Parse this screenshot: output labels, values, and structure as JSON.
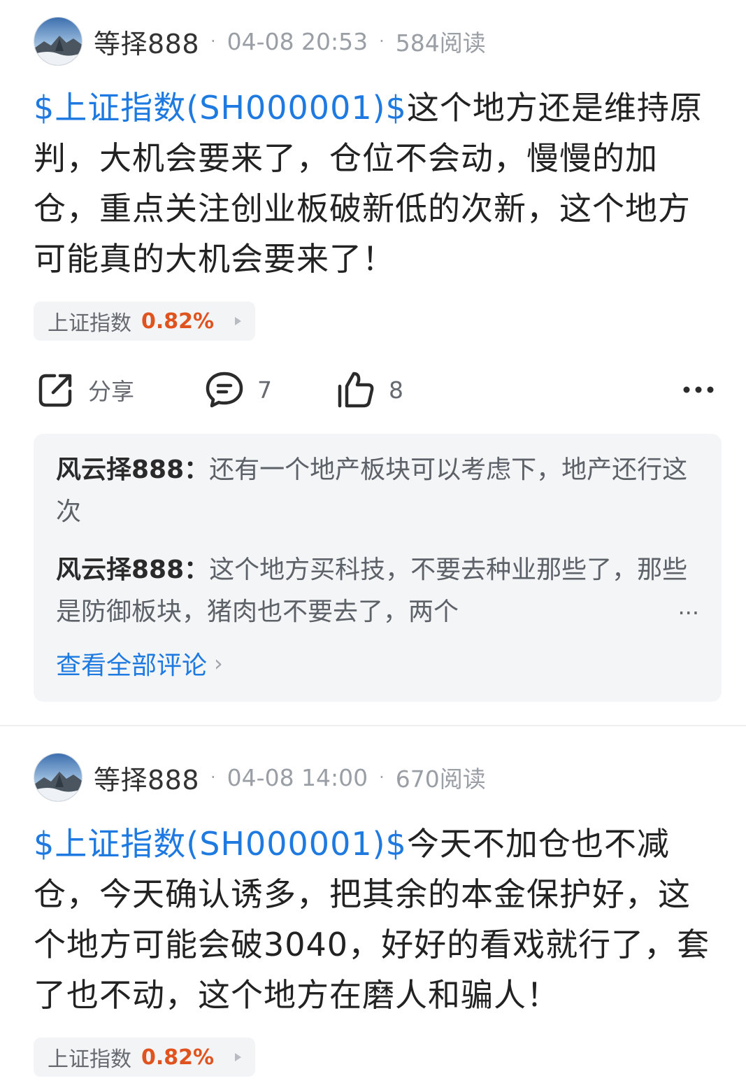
{
  "posts": [
    {
      "username": "等择888",
      "timestamp": "04-08 20:53",
      "reads": "584阅读",
      "tag": "$上证指数(SH000001)$",
      "text": "这个地方还是维持原判，大机会要来了，仓位不会动，慢慢的加仓，重点关注创业板破新低的次新，这个地方可能真的大机会要来了！",
      "quote": {
        "name": "上证指数",
        "change": "0.82%"
      },
      "actions": {
        "share_label": "分享",
        "comment_count": "7",
        "like_count": "8"
      },
      "comments": [
        {
          "author": "风云择888",
          "separator": "：",
          "text": "还有一个地产板块可以考虑下，地产还行这次"
        },
        {
          "author": "风云择888",
          "separator": "：",
          "text": "这个地方买科技，不要去种业那些了，那些是防御板块，猪肉也不要去了，两个"
        }
      ],
      "truncation": "...",
      "view_all_label": "查看全部评论"
    },
    {
      "username": "等择888",
      "timestamp": "04-08 14:00",
      "reads": "670阅读",
      "tag": "$上证指数(SH000001)$",
      "text": "今天不加仓也不减仓，今天确认诱多，把其余的本金保护好，这个地方可能会破3040，好好的看戏就行了，套了也不动，这个地方在磨人和骗人！",
      "quote": {
        "name": "上证指数",
        "change": "0.82%"
      }
    }
  ],
  "colors": {
    "link": "#1e7ae0",
    "rise": "#e0531f",
    "muted": "#9a9ea5"
  },
  "icons": [
    "avatar-mountain",
    "share-icon",
    "comment-icon",
    "like-icon",
    "more-icon",
    "chevron-right-icon"
  ]
}
